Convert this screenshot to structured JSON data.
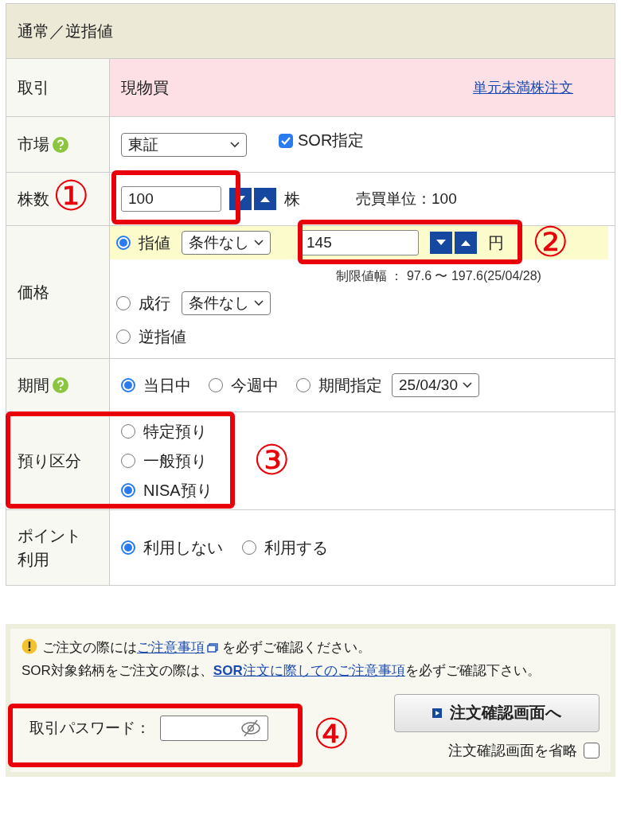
{
  "header": {
    "title": "通常／逆指値"
  },
  "trade": {
    "label": "取引",
    "value": "現物買",
    "link": "単元未満株注文"
  },
  "market": {
    "label": "市場",
    "select": "東証",
    "sor": {
      "label": "SOR指定",
      "checked": true
    }
  },
  "shares": {
    "label": "株数",
    "value": "100",
    "unit": "株",
    "lot": "売買単位：100"
  },
  "price": {
    "label": "価格",
    "options": [
      {
        "label": "指値",
        "selected": true,
        "condition": "条件なし",
        "value": "145",
        "unit": "円",
        "range": "制限値幅 ： 97.6 〜 197.6(25/04/28)"
      },
      {
        "label": "成行",
        "selected": false,
        "condition": "条件なし"
      },
      {
        "label": "逆指値",
        "selected": false
      }
    ]
  },
  "period": {
    "label": "期間",
    "options": [
      {
        "label": "当日中",
        "selected": true
      },
      {
        "label": "今週中",
        "selected": false
      },
      {
        "label": "期間指定",
        "selected": false
      }
    ],
    "date": "25/04/30"
  },
  "account": {
    "label": "預り区分",
    "options": [
      {
        "label": "特定預り",
        "selected": false
      },
      {
        "label": "一般預り",
        "selected": false
      },
      {
        "label": "NISA預り",
        "selected": true
      }
    ]
  },
  "points": {
    "label": "ポイント利用",
    "options": [
      {
        "label": "利用しない",
        "selected": true
      },
      {
        "label": "利用する",
        "selected": false
      }
    ]
  },
  "notice": {
    "line1": {
      "prefix": "ご注文の際には",
      "link": "ご注意事項",
      "suffix": "を必ずご確認ください。"
    },
    "line2": {
      "prefix": "SOR対象銘柄をご注文の際は、",
      "link": "**SOR**注文に際してのご注意事項",
      "suffix": "を必ずご確認下さい。"
    }
  },
  "password": {
    "label": "取引パスワード："
  },
  "confirm_button": "注文確認画面へ",
  "skip": {
    "label": "注文確認画面を省略",
    "checked": false
  },
  "annotations": [
    "①",
    "②",
    "③",
    "④"
  ]
}
